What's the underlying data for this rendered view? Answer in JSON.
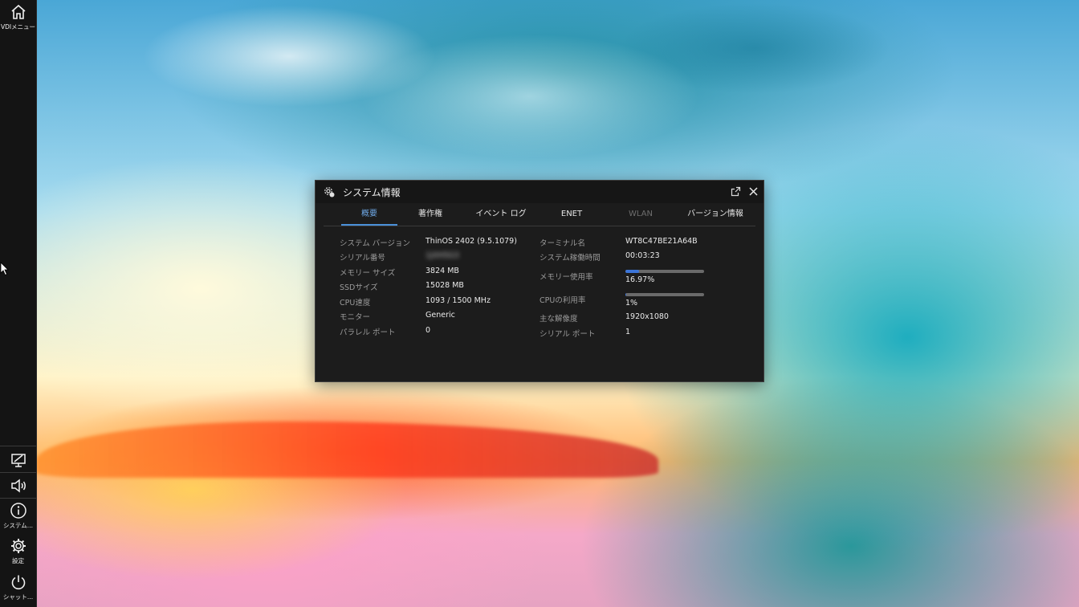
{
  "taskbar": {
    "vdi_menu_label": "VDIメニュー",
    "system_label": "システム...",
    "settings_label": "設定",
    "shutdown_label": "シャット..."
  },
  "window": {
    "title": "システム情報",
    "tabs": [
      {
        "label": "概要",
        "state": "active"
      },
      {
        "label": "著作権",
        "state": "normal"
      },
      {
        "label": "イベント ログ",
        "state": "normal"
      },
      {
        "label": "ENET",
        "state": "normal"
      },
      {
        "label": "WLAN",
        "state": "disabled"
      },
      {
        "label": "バージョン情報",
        "state": "normal"
      }
    ]
  },
  "overview": {
    "left": [
      {
        "label": "システム バージョン",
        "value": "ThinOS 2402 (9.5.1079)"
      },
      {
        "label": "シリアル番号",
        "value": "1JXH5G3"
      },
      {
        "label": "メモリー サイズ",
        "value": "3824 MB"
      },
      {
        "label": "SSDサイズ",
        "value": "15028 MB"
      },
      {
        "label": "CPU速度",
        "value": "1093 / 1500 MHz"
      },
      {
        "label": "モニター",
        "value": "Generic"
      },
      {
        "label": "パラレル ポート",
        "value": "0"
      }
    ],
    "right": {
      "terminal_name_label": "ターミナル名",
      "terminal_name": "WT8C47BE21A64B",
      "uptime_label": "システム稼働時間",
      "uptime": "00:03:23",
      "memory_usage_label": "メモリー使用率",
      "memory_usage_text": "16.97%",
      "memory_usage_fraction": 0.1697,
      "cpu_usage_label": "CPUの利用率",
      "cpu_usage_text": "1%",
      "cpu_usage_fraction": 0.01,
      "resolution_label": "主な解像度",
      "resolution": "1920x1080",
      "serial_port_label": "シリアル ポート",
      "serial_port": "1"
    }
  },
  "colors": {
    "accent": "#4a90d9",
    "window_bg": "#1c1c1c",
    "taskbar_bg": "#141414"
  }
}
